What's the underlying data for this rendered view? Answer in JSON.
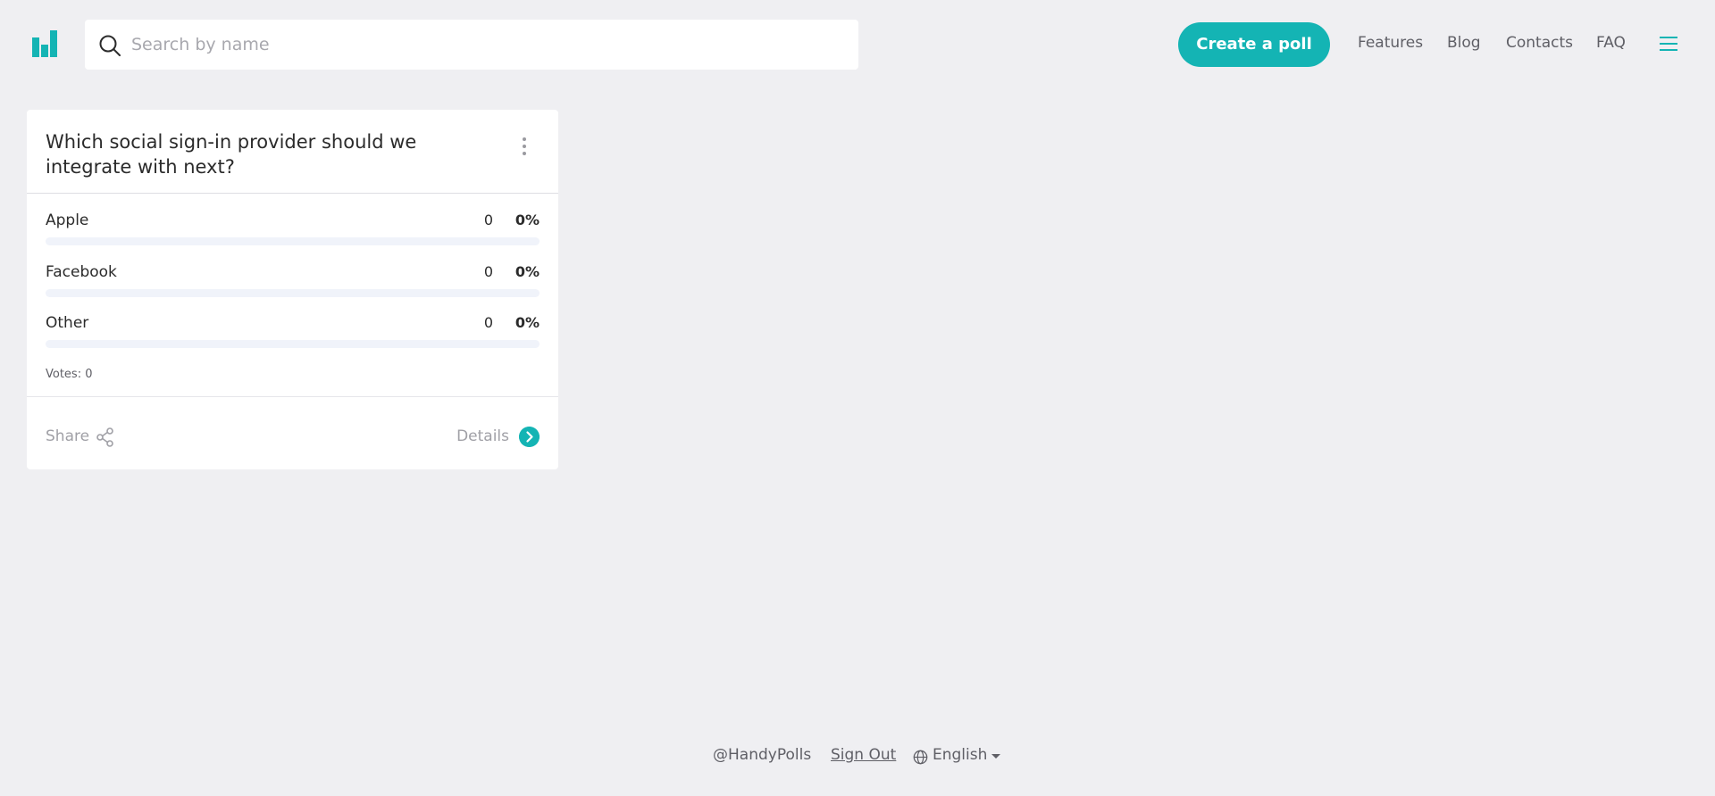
{
  "header": {
    "logo_icon": "bar-chart-icon",
    "search": {
      "placeholder": "Search by name",
      "value": "",
      "icon": "search-icon"
    },
    "create_label": "Create a poll",
    "nav": [
      "Features",
      "Blog",
      "Contacts",
      "FAQ"
    ],
    "menu_icon": "hamburger-icon"
  },
  "poll": {
    "title": "Which social sign-in provider should we integrate with next?",
    "options": [
      {
        "label": "Apple",
        "count": "0",
        "percent": "0%",
        "fraction": 0
      },
      {
        "label": "Facebook",
        "count": "0",
        "percent": "0%",
        "fraction": 0
      },
      {
        "label": "Other",
        "count": "0",
        "percent": "0%",
        "fraction": 0
      }
    ],
    "votes": "Votes: 0",
    "share_label": "Share",
    "details_label": "Details"
  },
  "footer": {
    "handle": "@HandyPolls",
    "signout": "Sign Out",
    "language": "English"
  },
  "colors": {
    "accent": "#14b4b4",
    "background": "#efeff2",
    "card": "#ffffff"
  }
}
